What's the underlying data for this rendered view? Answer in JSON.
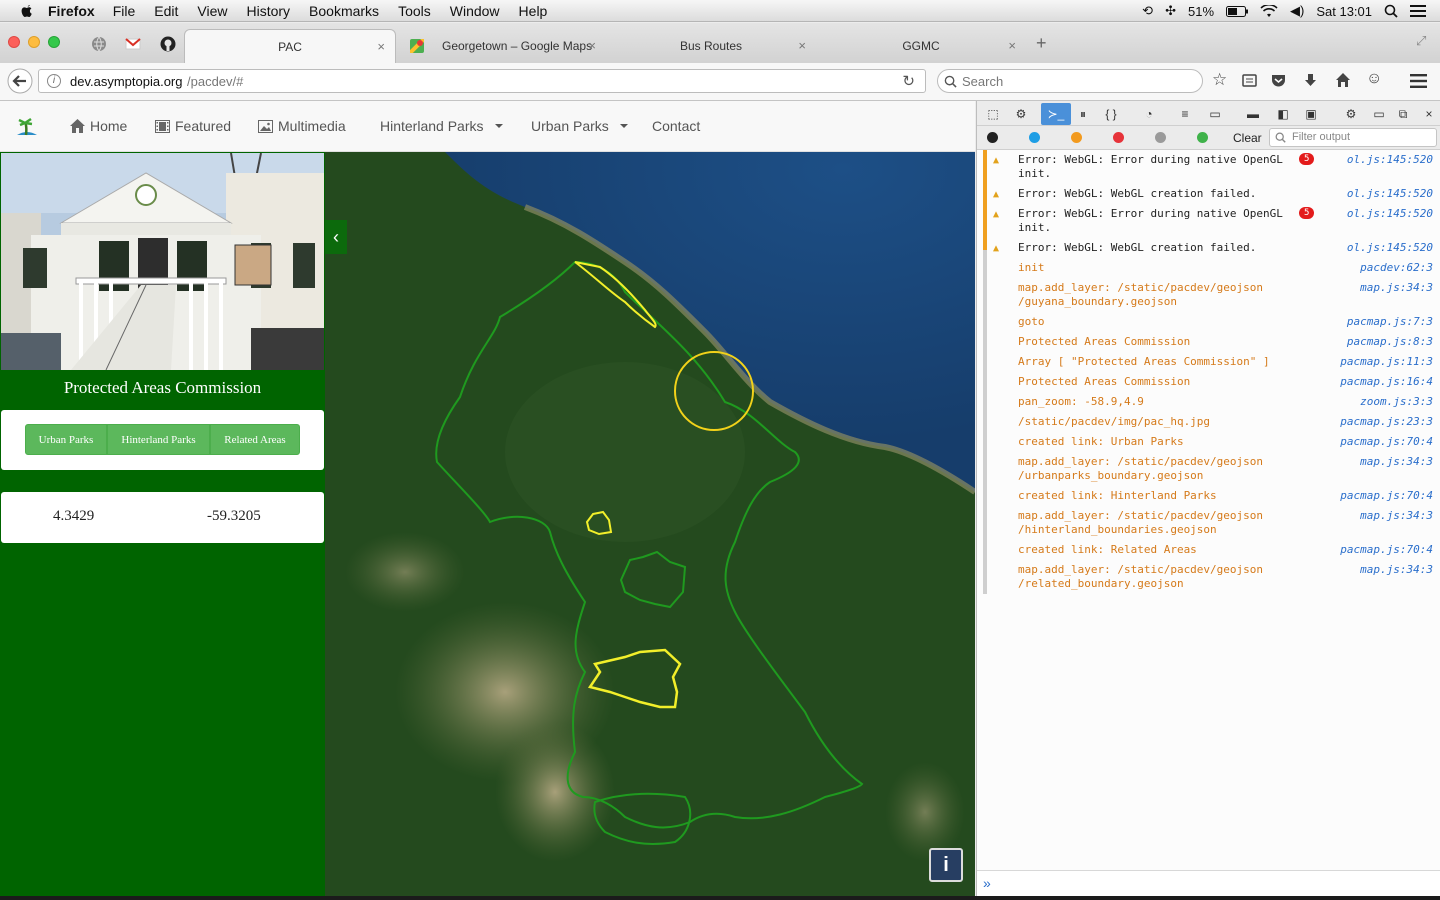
{
  "menubar": {
    "app": "Firefox",
    "items": [
      "File",
      "Edit",
      "View",
      "History",
      "Bookmarks",
      "Tools",
      "Window",
      "Help"
    ],
    "battery": "51%",
    "clock": "Sat 13:01"
  },
  "tabs": [
    {
      "label": "PAC",
      "active": true
    },
    {
      "label": "Georgetown – Google Maps"
    },
    {
      "label": "Bus Routes"
    },
    {
      "label": "GGMC"
    }
  ],
  "navbar": {
    "url_domain": "dev.asymptopia.org",
    "url_path": "/pacdev/#",
    "search_placeholder": "Search"
  },
  "site": {
    "nav": {
      "home": "Home",
      "featured": "Featured",
      "multimedia": "Multimedia",
      "hinterland": "Hinterland Parks",
      "urban": "Urban Parks",
      "contact": "Contact"
    },
    "sidebar": {
      "title": "Protected Areas Commission",
      "buttons": [
        "Urban Parks",
        "Hinterland Parks",
        "Related Areas"
      ],
      "coords": {
        "lat": "4.3429",
        "lon": "-59.3205"
      }
    },
    "map": {
      "collapse_glyph": "‹",
      "info_label": "i"
    },
    "colors": {
      "sidebar": "#006400",
      "button": "#5cb85c",
      "boundary": "#1f9a1f",
      "parks": "#f2ef2a",
      "highlight": "#f2d21a"
    }
  },
  "devtools": {
    "clear_label": "Clear",
    "filter_placeholder": "Filter output",
    "messages": [
      {
        "type": "warn",
        "text": "Error: WebGL: Error during native OpenGL\ninit.",
        "src": "ol.js:145:520",
        "badge": "5"
      },
      {
        "type": "warn",
        "text": "Error: WebGL: WebGL creation failed.",
        "src": "ol.js:145:520"
      },
      {
        "type": "warn",
        "text": "Error: WebGL: Error during native OpenGL\ninit.",
        "src": "ol.js:145:520",
        "badge": "5"
      },
      {
        "type": "warn",
        "text": "Error: WebGL: WebGL creation failed.",
        "src": "ol.js:145:520"
      },
      {
        "type": "log",
        "text": "init",
        "src": "pacdev:62:3"
      },
      {
        "type": "log",
        "text": "map.add_layer: /static/pacdev/geojson\n/guyana_boundary.geojson",
        "src": "map.js:34:3"
      },
      {
        "type": "log",
        "text": "goto",
        "src": "pacmap.js:7:3"
      },
      {
        "type": "log",
        "text": "Protected Areas Commission",
        "src": "pacmap.js:8:3"
      },
      {
        "type": "log",
        "text": "Array [ \"Protected Areas Commission\" ]",
        "src": "pacmap.js:11:3"
      },
      {
        "type": "log",
        "text": "Protected Areas Commission",
        "src": "pacmap.js:16:4"
      },
      {
        "type": "log",
        "text": "pan_zoom: -58.9,4.9",
        "src": "zoom.js:3:3"
      },
      {
        "type": "log",
        "text": "/static/pacdev/img/pac_hq.jpg",
        "src": "pacmap.js:23:3"
      },
      {
        "type": "log",
        "text": "created link: Urban Parks",
        "src": "pacmap.js:70:4"
      },
      {
        "type": "log",
        "text": "map.add_layer: /static/pacdev/geojson\n/urbanparks_boundary.geojson",
        "src": "map.js:34:3"
      },
      {
        "type": "log",
        "text": "created link: Hinterland Parks",
        "src": "pacmap.js:70:4"
      },
      {
        "type": "log",
        "text": "map.add_layer: /static/pacdev/geojson\n/hinterland_boundaries.geojson",
        "src": "map.js:34:3"
      },
      {
        "type": "log",
        "text": "created link: Related Areas",
        "src": "pacmap.js:70:4"
      },
      {
        "type": "log",
        "text": "map.add_layer: /static/pacdev/geojson\n/related_boundary.geojson",
        "src": "map.js:34:3"
      }
    ],
    "prompt": "»"
  }
}
